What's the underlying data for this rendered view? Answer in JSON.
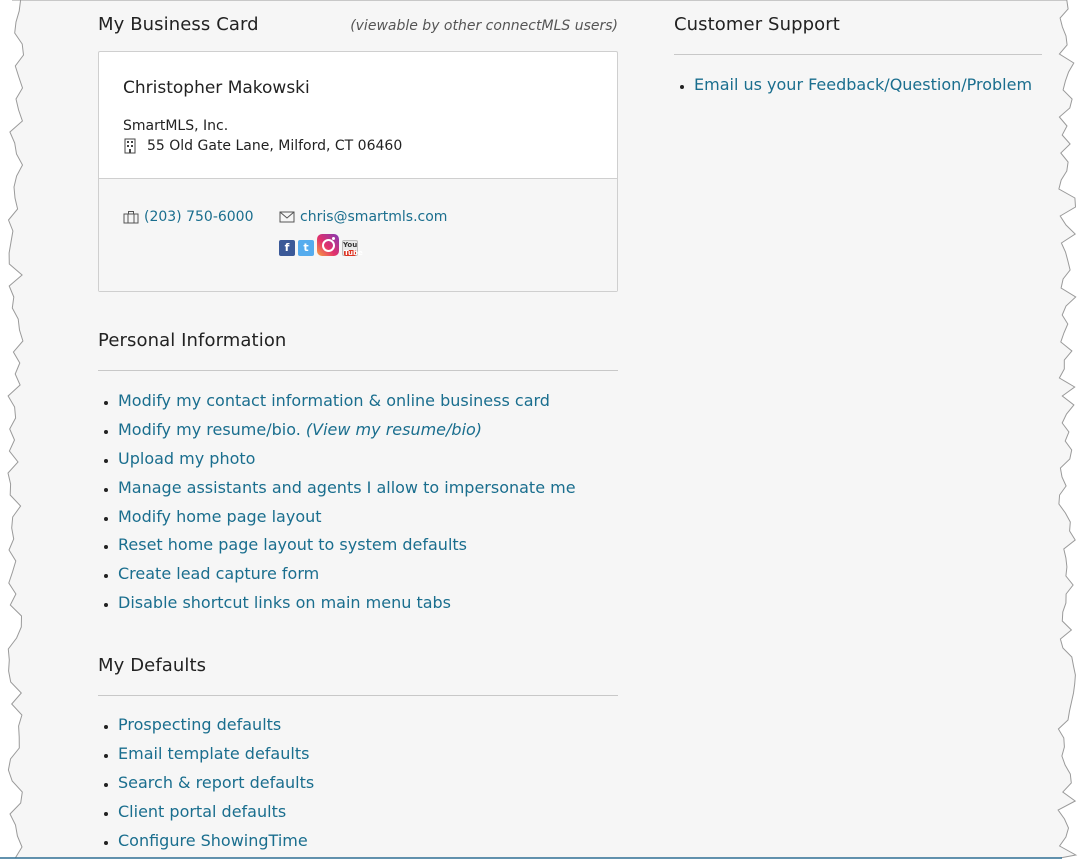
{
  "business_card": {
    "title": "My Business Card",
    "note": "(viewable by other connectMLS users)",
    "name": "Christopher Makowski",
    "company": "SmartMLS, Inc.",
    "address": "55 Old Gate Lane, Milford, CT 06460",
    "phone": "(203) 750-6000",
    "email": "chris@smartmls.com",
    "social_icons": [
      "facebook-icon",
      "twitter-icon",
      "instagram-icon",
      "youtube-icon"
    ]
  },
  "personal": {
    "title": "Personal Information",
    "items": [
      {
        "label": "Modify my contact information & online business card"
      },
      {
        "label": "Modify my resume/bio.",
        "extra": "(View my resume/bio)"
      },
      {
        "label": "Upload my photo"
      },
      {
        "label": "Manage assistants and agents I allow to impersonate me"
      },
      {
        "label": "Modify home page layout"
      },
      {
        "label": "Reset home page layout to system defaults"
      },
      {
        "label": "Create lead capture form"
      },
      {
        "label": "Disable shortcut links on main menu tabs"
      }
    ]
  },
  "defaults": {
    "title": "My Defaults",
    "items": [
      {
        "label": "Prospecting defaults"
      },
      {
        "label": "Email template defaults"
      },
      {
        "label": "Search & report defaults"
      },
      {
        "label": "Client portal defaults"
      },
      {
        "label": "Configure ShowingTime"
      }
    ]
  },
  "support": {
    "title": "Customer Support",
    "items": [
      {
        "label": "Email us your Feedback/Question/Problem"
      }
    ]
  },
  "colors": {
    "link": "#1a6e8e",
    "page_bg": "#f6f6f6",
    "rule": "#c8c8c8"
  }
}
